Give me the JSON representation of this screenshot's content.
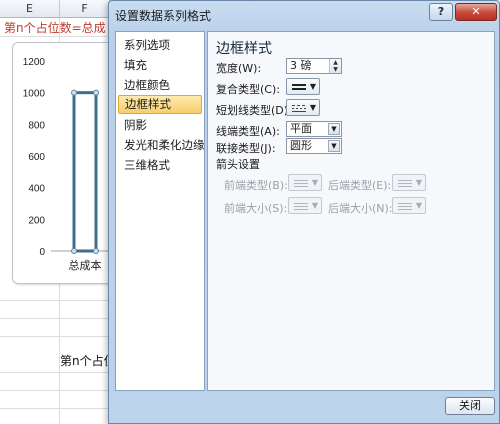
{
  "sheet": {
    "columns": [
      "E",
      "F"
    ],
    "formula_text": "第n个占位数=总成",
    "caption_text": "第n个占位"
  },
  "chart_data": {
    "type": "bar",
    "categories": [
      "总成本"
    ],
    "values": [
      1000
    ],
    "ylim": [
      0,
      1200
    ],
    "y_ticks": [
      "1200",
      "1000",
      "800",
      "600",
      "400",
      "200",
      "0"
    ],
    "title": "",
    "xlabel": "",
    "ylabel": "",
    "bar_outline_color": "#3f6f8f",
    "bar_fill": "none"
  },
  "dialog": {
    "title": "设置数据系列格式",
    "help_label": "?",
    "close_x_label": "✕",
    "nav_items": [
      "系列选项",
      "填充",
      "边框颜色",
      "边框样式",
      "阴影",
      "发光和柔化边缘",
      "三维格式"
    ],
    "selected_nav_index": 3,
    "panel": {
      "heading": "边框样式",
      "width_label": "宽度(W):",
      "width_value": "3 磅",
      "compound_label": "复合类型(C):",
      "dash_label": "短划线类型(D):",
      "cap_label": "线端类型(A):",
      "cap_value": "平面",
      "join_label": "联接类型(J):",
      "join_value": "圆形",
      "arrow_section": "箭头设置",
      "begin_type_label": "前端类型(B):",
      "end_type_label": "后端类型(E):",
      "begin_size_label": "前端大小(S):",
      "end_size_label": "后端大小(N):"
    },
    "close_button_label": "关闭"
  }
}
